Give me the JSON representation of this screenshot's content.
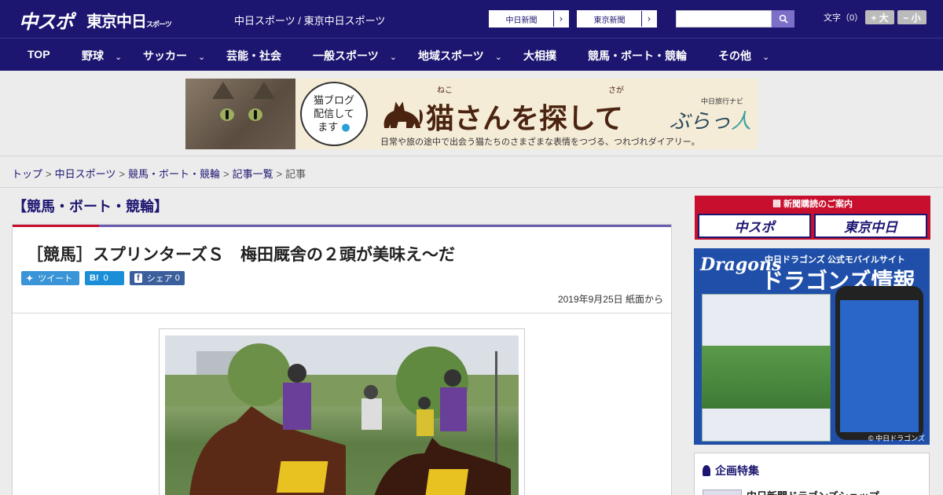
{
  "header": {
    "logo_chuspo": "中スポ",
    "logo_tokyo": "東京中日",
    "logo_tokyo_small": "スポーツ",
    "site_name": "中日スポーツ / 東京中日スポーツ",
    "paper_buttons": [
      {
        "label": "中日新聞"
      },
      {
        "label": "東京新聞"
      }
    ],
    "search": {
      "value": ""
    },
    "font_label": "文字（0）",
    "font_larger": "+ 大",
    "font_smaller": "− 小"
  },
  "nav": {
    "items": [
      {
        "label": "TOP",
        "dropdown": false
      },
      {
        "label": "野球",
        "dropdown": true
      },
      {
        "label": "サッカー",
        "dropdown": true
      },
      {
        "label": "芸能・社会",
        "dropdown": false
      },
      {
        "label": "一般スポーツ",
        "dropdown": true
      },
      {
        "label": "地域スポーツ",
        "dropdown": true
      },
      {
        "label": "大相撲",
        "dropdown": false
      },
      {
        "label": "競馬・ボート・競輪",
        "dropdown": false
      },
      {
        "label": "その他",
        "dropdown": true
      }
    ]
  },
  "banner": {
    "bubble_text_1": "猫ブログ",
    "bubble_text_2": "配信して",
    "bubble_text_3": "ます",
    "ruby_neko": "ねこ",
    "ruby_saga": "さが",
    "title": "猫さんを探して",
    "navi": "中日旅行ナビ",
    "brand": "ぶらっ",
    "brand_accent": "人",
    "subtitle": "日常や旅の途中で出会う猫たちのさまざまな表情をつづる、つれづれダイアリー。"
  },
  "breadcrumb": {
    "items": [
      {
        "label": "トップ",
        "link": true
      },
      {
        "label": "中日スポーツ",
        "link": true
      },
      {
        "label": "競馬・ボート・競輪",
        "link": true
      },
      {
        "label": "記事一覧",
        "link": true
      },
      {
        "label": "記事",
        "link": false
      }
    ],
    "separator": ">"
  },
  "category_heading": "【競馬・ボート・競輪】",
  "article": {
    "title": "［競馬］スプリンターズＳ　梅田厩舎の２頭が美味え～だ",
    "share": {
      "tweet": "ツイート",
      "hatena_icon": "B!",
      "hatena_count": "0",
      "facebook": "シェア",
      "facebook_count": "0"
    },
    "date": "2019年9月25日 紙面から"
  },
  "sidebar": {
    "subscription_head": "新聞購読のご案内",
    "subscription_logos": [
      "中スポ",
      "東京中日"
    ],
    "dragons_brand": "Dragons",
    "dragons_sub": "中日ドラゴンズ 公式モバイルサイト",
    "dragons_big": "ドラゴンズ情報",
    "dragons_copyright": "© 中日ドラゴンズ",
    "kikaku_title": "企画特集",
    "kikaku_item": "中日新聞ドラゴンズショップ"
  },
  "colors": {
    "header_bg": "#1c1670",
    "accent_red": "#c8102e",
    "accent_purple": "#6b5db0",
    "twitter": "#3a95d8",
    "hatena": "#1b8ed8",
    "facebook": "#3b5e9c"
  }
}
